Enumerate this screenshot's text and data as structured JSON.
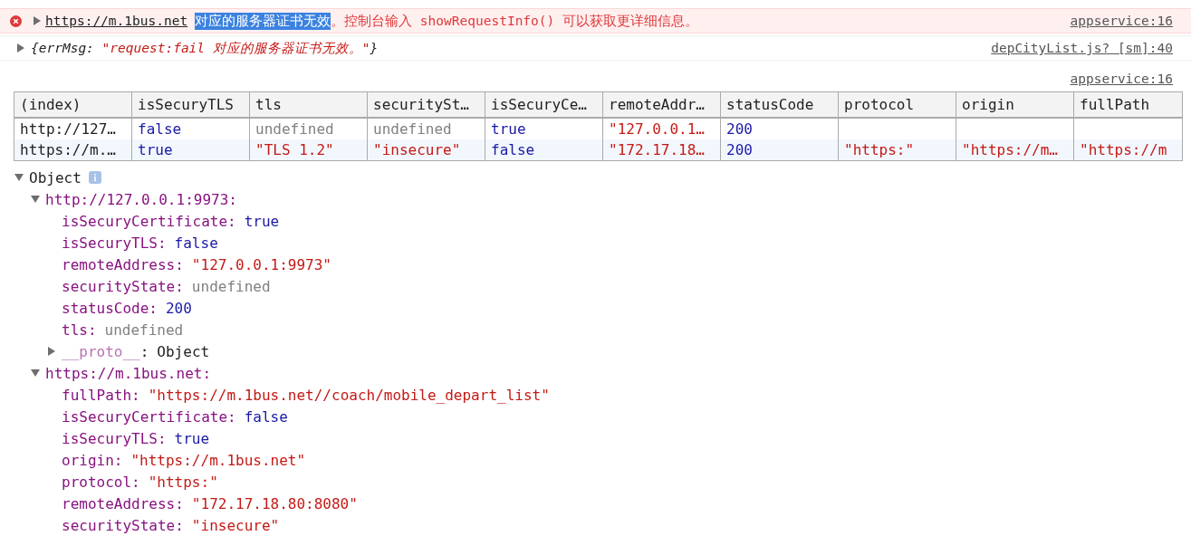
{
  "console": [
    {
      "kind": "error",
      "expanded": false,
      "source": "appservice:16",
      "segments": [
        {
          "kind": "link",
          "text": "https://m.1bus.net",
          "selected": false
        },
        {
          "kind": "text",
          "text": "对应的服务器证书无效",
          "selected": true
        },
        {
          "kind": "text",
          "text": "。控制台输入 showRequestInfo() 可以获取更详细信息。",
          "selected": false
        }
      ]
    },
    {
      "kind": "object",
      "expanded": false,
      "source": "depCityList.js? [sm]:40",
      "segments": [
        {
          "kind": "punct",
          "text": "{errMsg: ",
          "selected": false
        },
        {
          "kind": "string",
          "text": "\"request:fail 对应的服务器证书无效。\"",
          "selected": false
        },
        {
          "kind": "punct",
          "text": "}",
          "selected": false
        }
      ]
    }
  ],
  "table_source": "appservice:16",
  "table": {
    "columns": [
      "(index)",
      "isSecuryTLS",
      "tls",
      "securitySt…",
      "isSecuryCe…",
      "remoteAddr…",
      "statusCode",
      "protocol",
      "origin",
      "fullPath"
    ],
    "rows": [
      {
        "cells": [
          {
            "text": "http://127…",
            "kind": "plain"
          },
          {
            "text": "false",
            "kind": "bool"
          },
          {
            "text": "undefined",
            "kind": "undef"
          },
          {
            "text": "undefined",
            "kind": "undef"
          },
          {
            "text": "true",
            "kind": "bool"
          },
          {
            "text": "\"127.0.0.1…",
            "kind": "str"
          },
          {
            "text": "200",
            "kind": "num"
          },
          {
            "kind": "empty"
          },
          {
            "kind": "empty"
          },
          {
            "kind": "empty"
          }
        ]
      },
      {
        "cells": [
          {
            "text": "https://m.…",
            "kind": "plain"
          },
          {
            "text": "true",
            "kind": "bool"
          },
          {
            "text": "\"TLS 1.2\"",
            "kind": "str"
          },
          {
            "text": "\"insecure\"",
            "kind": "str"
          },
          {
            "text": "false",
            "kind": "bool"
          },
          {
            "text": "\"172.17.18…",
            "kind": "str"
          },
          {
            "text": "200",
            "kind": "num"
          },
          {
            "text": "\"https:\"",
            "kind": "str"
          },
          {
            "text": "\"https://m…",
            "kind": "str"
          },
          {
            "text": "\"https://m",
            "kind": "str"
          }
        ]
      }
    ]
  },
  "tree": {
    "label": "Object",
    "expanded": true,
    "children": [
      {
        "kind": "group",
        "key": "http://127.0.0.1:9973:",
        "expanded": true,
        "children": [
          {
            "kind": "prop",
            "key": "isSecuryCertificate:",
            "value": {
              "text": "true",
              "kind": "bool"
            }
          },
          {
            "kind": "prop",
            "key": "isSecuryTLS:",
            "value": {
              "text": "false",
              "kind": "bool"
            }
          },
          {
            "kind": "prop",
            "key": "remoteAddress:",
            "value": {
              "text": "\"127.0.0.1:9973\"",
              "kind": "str"
            }
          },
          {
            "kind": "prop",
            "key": "securityState:",
            "value": {
              "text": "undefined",
              "kind": "undef"
            }
          },
          {
            "kind": "prop",
            "key": "statusCode:",
            "value": {
              "text": "200",
              "kind": "num"
            }
          },
          {
            "kind": "prop",
            "key": "tls:",
            "value": {
              "text": "undefined",
              "kind": "undef"
            }
          },
          {
            "kind": "proto",
            "key": "__proto__",
            "sep": ":",
            "value": {
              "text": "Object",
              "kind": "plain"
            },
            "expanded": false
          }
        ]
      },
      {
        "kind": "group",
        "key": "https://m.1bus.net:",
        "expanded": true,
        "children": [
          {
            "kind": "prop",
            "key": "fullPath:",
            "value": {
              "text": "\"https://m.1bus.net//coach/mobile_depart_list\"",
              "kind": "str"
            }
          },
          {
            "kind": "prop",
            "key": "isSecuryCertificate:",
            "value": {
              "text": "false",
              "kind": "bool"
            }
          },
          {
            "kind": "prop",
            "key": "isSecuryTLS:",
            "value": {
              "text": "true",
              "kind": "bool"
            }
          },
          {
            "kind": "prop",
            "key": "origin:",
            "value": {
              "text": "\"https://m.1bus.net\"",
              "kind": "str"
            }
          },
          {
            "kind": "prop",
            "key": "protocol:",
            "value": {
              "text": "\"https:\"",
              "kind": "str"
            }
          },
          {
            "kind": "prop",
            "key": "remoteAddress:",
            "value": {
              "text": "\"172.17.18.80:8080\"",
              "kind": "str"
            }
          },
          {
            "kind": "prop",
            "key": "securityState:",
            "value": {
              "text": "\"insecure\"",
              "kind": "str"
            }
          }
        ]
      }
    ]
  }
}
